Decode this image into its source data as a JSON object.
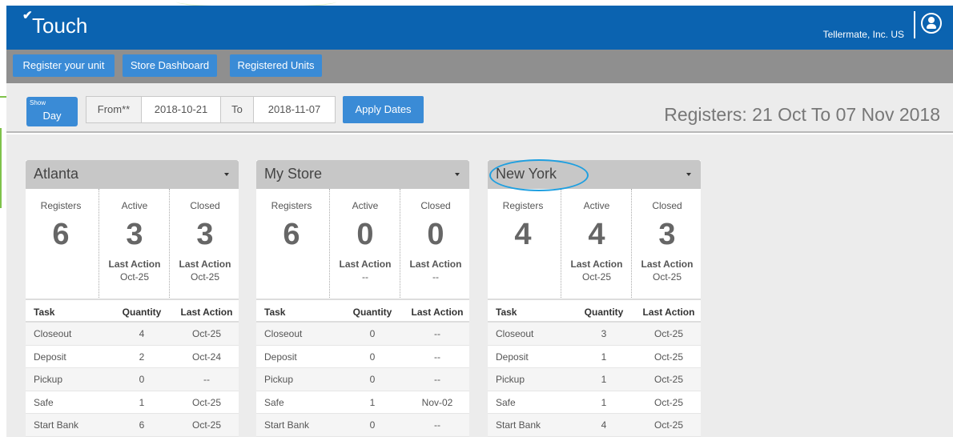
{
  "header": {
    "logo_text": "Touch",
    "logo_mark": "✔",
    "company": "Tellermate, Inc. US",
    "user_icon": "user-circle-icon"
  },
  "nav": {
    "buttons": [
      "Register your unit",
      "Store Dashboard",
      "Registered Units"
    ]
  },
  "filter": {
    "show_small": "Show",
    "show_value": "Day",
    "from_label": "From**",
    "from_date": "2018-10-21",
    "to_label": "To",
    "to_date": "2018-11-07",
    "apply_label": "Apply Dates",
    "page_title": "Registers: 21 Oct To 07 Nov 2018"
  },
  "stat_labels": {
    "registers": "Registers",
    "active": "Active",
    "closed": "Closed",
    "last_action": "Last Action"
  },
  "table_headers": {
    "task": "Task",
    "quantity": "Quantity",
    "last_action": "Last Action"
  },
  "stores": [
    {
      "name": "Atlanta",
      "registers": "6",
      "active": "3",
      "closed": "3",
      "active_last_action": "Oct-25",
      "closed_last_action": "Oct-25",
      "tasks": [
        {
          "task": "Closeout",
          "qty": "4",
          "last": "Oct-25"
        },
        {
          "task": "Deposit",
          "qty": "2",
          "last": "Oct-24"
        },
        {
          "task": "Pickup",
          "qty": "0",
          "last": "--"
        },
        {
          "task": "Safe",
          "qty": "1",
          "last": "Oct-25"
        },
        {
          "task": "Start Bank",
          "qty": "6",
          "last": "Oct-25"
        }
      ]
    },
    {
      "name": "My Store",
      "registers": "6",
      "active": "0",
      "closed": "0",
      "active_last_action": "--",
      "closed_last_action": "--",
      "tasks": [
        {
          "task": "Closeout",
          "qty": "0",
          "last": "--"
        },
        {
          "task": "Deposit",
          "qty": "0",
          "last": "--"
        },
        {
          "task": "Pickup",
          "qty": "0",
          "last": "--"
        },
        {
          "task": "Safe",
          "qty": "1",
          "last": "Nov-02"
        },
        {
          "task": "Start Bank",
          "qty": "0",
          "last": "--"
        }
      ]
    },
    {
      "name": "New York",
      "registers": "4",
      "active": "4",
      "closed": "3",
      "active_last_action": "Oct-25",
      "closed_last_action": "Oct-25",
      "tasks": [
        {
          "task": "Closeout",
          "qty": "3",
          "last": "Oct-25"
        },
        {
          "task": "Deposit",
          "qty": "1",
          "last": "Oct-25"
        },
        {
          "task": "Pickup",
          "qty": "1",
          "last": "Oct-25"
        },
        {
          "task": "Safe",
          "qty": "1",
          "last": "Oct-25"
        },
        {
          "task": "Start Bank",
          "qty": "4",
          "last": "Oct-25"
        }
      ]
    }
  ]
}
